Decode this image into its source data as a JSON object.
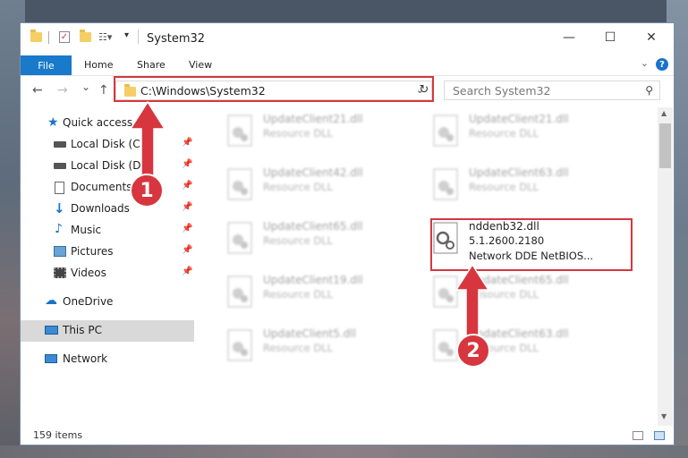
{
  "window": {
    "title": "System32",
    "controls": {
      "minimize": "—",
      "maximize": "☐",
      "close": "✕"
    }
  },
  "ribbon": {
    "tabs": [
      "File",
      "Home",
      "Share",
      "View"
    ],
    "help": "?"
  },
  "navigation": {
    "back": "←",
    "forward": "→",
    "recent": "⌄",
    "up": "↑",
    "address": "C:\\Windows\\System32",
    "search_placeholder": "Search System32"
  },
  "sidebar": {
    "items": [
      {
        "label": "Quick access",
        "icon": "star-icon"
      },
      {
        "label": "Local Disk (C:)",
        "icon": "drive-icon",
        "pinned": true
      },
      {
        "label": "Local Disk (D:)",
        "icon": "drive-icon",
        "pinned": true
      },
      {
        "label": "Documents",
        "icon": "documents-icon",
        "pinned": true
      },
      {
        "label": "Downloads",
        "icon": "downloads-icon",
        "pinned": true
      },
      {
        "label": "Music",
        "icon": "music-icon",
        "pinned": true
      },
      {
        "label": "Pictures",
        "icon": "pictures-icon",
        "pinned": true
      },
      {
        "label": "Videos",
        "icon": "videos-icon",
        "pinned": true
      },
      {
        "label": "OneDrive",
        "icon": "cloud-icon"
      },
      {
        "label": "This PC",
        "icon": "computer-icon",
        "selected": true
      },
      {
        "label": "Network",
        "icon": "network-icon"
      }
    ]
  },
  "files": [
    {
      "name": "UpdateClient21.dll",
      "desc": "Resource DLL"
    },
    {
      "name": "UpdateClient21.dll",
      "desc": "Resource DLL"
    },
    {
      "name": "UpdateClient42.dll",
      "desc": "Resource DLL"
    },
    {
      "name": "UpdateClient63.dll",
      "desc": "Resource DLL"
    },
    {
      "name": "UpdateClient65.dll",
      "desc": "Resource DLL"
    },
    {
      "name": "nddenb32.dll",
      "version": "5.1.2600.2180",
      "desc": "Network DDE NetBIOS..."
    },
    {
      "name": "UpdateClient19.dll",
      "desc": "Resource DLL"
    },
    {
      "name": "UpdateClient65.dll",
      "desc": "Resource DLL"
    },
    {
      "name": "UpdateClient5.dll",
      "desc": "Resource DLL"
    },
    {
      "name": "UpdateClient63.dll",
      "desc": "Resource DLL"
    }
  ],
  "status": {
    "item_count": "159 items"
  },
  "callouts": {
    "step1": "1",
    "step2": "2"
  },
  "colors": {
    "accent": "#1979ca",
    "highlight": "#d7363f",
    "selection": "#d9d9d9"
  }
}
